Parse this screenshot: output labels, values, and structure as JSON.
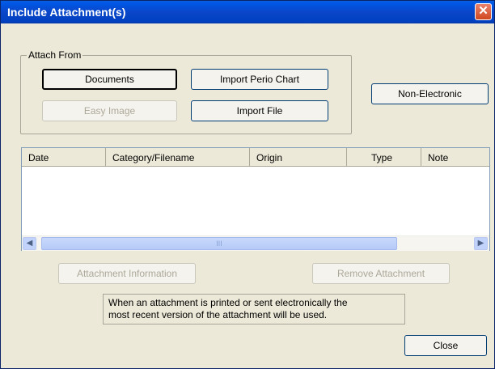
{
  "window": {
    "title": "Include Attachment(s)",
    "close_glyph": "✕"
  },
  "attach_from": {
    "label": "Attach From",
    "documents": "Documents",
    "import_perio_chart": "Import Perio Chart",
    "easy_image": "Easy Image",
    "import_file": "Import File"
  },
  "non_electronic": "Non-Electronic",
  "list": {
    "columns": [
      "Date",
      "Category/Filename",
      "Origin",
      "Type",
      "Note"
    ],
    "rows": []
  },
  "scrollbar": {
    "left_arrow": "◀",
    "right_arrow": "▶",
    "grip": "III"
  },
  "actions": {
    "attachment_information": "Attachment Information",
    "remove_attachment": "Remove Attachment",
    "close": "Close"
  },
  "info_text": {
    "line1": "When an attachment is printed or sent electronically the",
    "line2": "most recent version of the attachment will be used."
  },
  "colors": {
    "titlebar": "#0a46c8",
    "dialog_bg": "#ece9d8",
    "list_border": "#7f9db9"
  }
}
